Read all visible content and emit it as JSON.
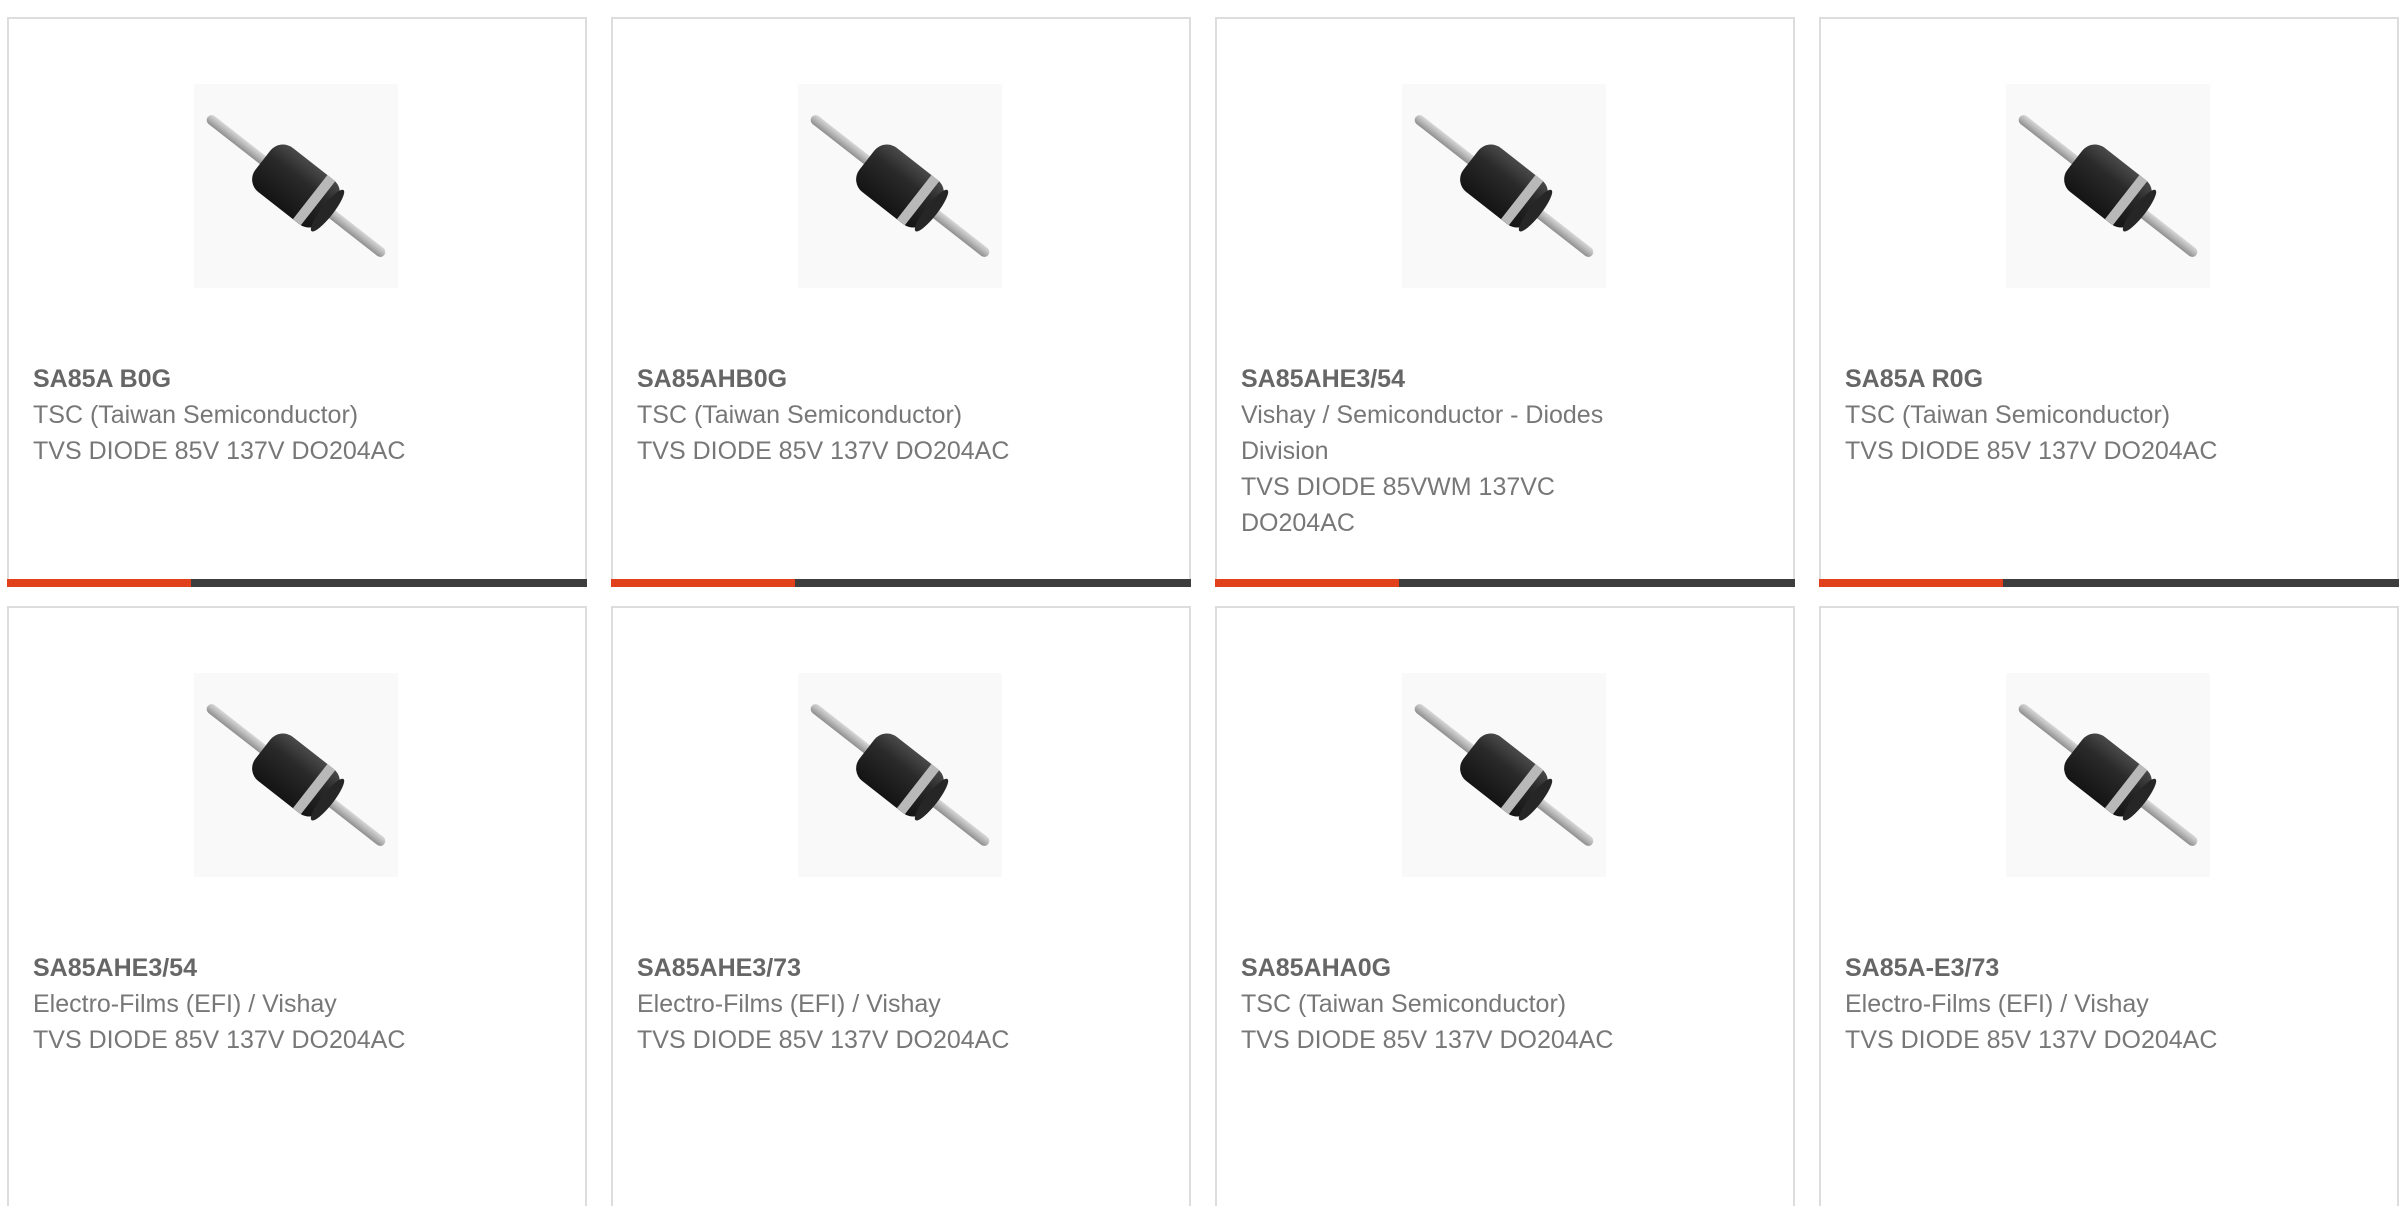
{
  "colors": {
    "accent": "#e0401c",
    "bar": "#3d3d3d",
    "text": "#777777",
    "border": "#dddddd"
  },
  "products": [
    {
      "part": "SA85A B0G",
      "manufacturer": "TSC (Taiwan Semiconductor)",
      "description": "TVS DIODE 85V 137V DO204AC",
      "icon": "axial-diode-icon"
    },
    {
      "part": "SA85AHB0G",
      "manufacturer": "TSC (Taiwan Semiconductor)",
      "description": "TVS DIODE 85V 137V DO204AC",
      "icon": "axial-diode-icon"
    },
    {
      "part": "SA85AHE3/54",
      "manufacturer": "Vishay / Semiconductor - Diodes Division",
      "description": "TVS DIODE 85VWM 137VC DO204AC",
      "icon": "axial-diode-icon"
    },
    {
      "part": "SA85A R0G",
      "manufacturer": "TSC (Taiwan Semiconductor)",
      "description": "TVS DIODE 85V 137V DO204AC",
      "icon": "axial-diode-icon"
    },
    {
      "part": "SA85AHE3/54",
      "manufacturer": "Electro-Films (EFI) / Vishay",
      "description": "TVS DIODE 85V 137V DO204AC",
      "icon": "axial-diode-icon"
    },
    {
      "part": "SA85AHE3/73",
      "manufacturer": "Electro-Films (EFI) / Vishay",
      "description": "TVS DIODE 85V 137V DO204AC",
      "icon": "axial-diode-icon"
    },
    {
      "part": "SA85AHA0G",
      "manufacturer": "TSC (Taiwan Semiconductor)",
      "description": "TVS DIODE 85V 137V DO204AC",
      "icon": "axial-diode-icon"
    },
    {
      "part": "SA85A-E3/73",
      "manufacturer": "Electro-Films (EFI) / Vishay",
      "description": "TVS DIODE 85V 137V DO204AC",
      "icon": "axial-diode-icon"
    }
  ]
}
